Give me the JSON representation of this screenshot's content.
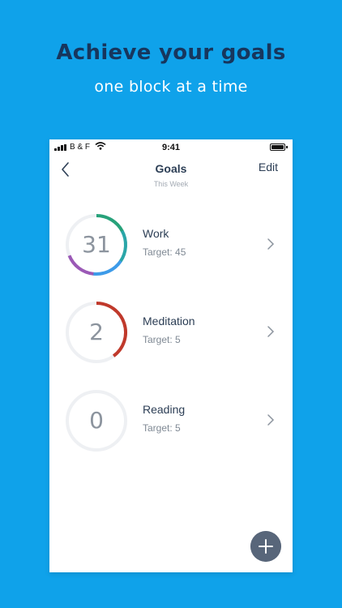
{
  "promo": {
    "headline": "Achieve your goals",
    "subline": "one block at a time"
  },
  "status_bar": {
    "carrier": "B & F",
    "time": "9:41"
  },
  "nav": {
    "title": "Goals",
    "subtitle": "This Week",
    "edit_label": "Edit",
    "back_icon": "chevron-left-icon"
  },
  "goals": [
    {
      "name": "Work",
      "count": "31",
      "target": "Target: 45",
      "progress": 0.69,
      "colors": [
        "#27a27a",
        "#2aa6a8",
        "#3d9be9",
        "#9b59b6"
      ]
    },
    {
      "name": "Meditation",
      "count": "2",
      "target": "Target: 5",
      "progress": 0.4,
      "colors": [
        "#c0392b"
      ]
    },
    {
      "name": "Reading",
      "count": "0",
      "target": "Target: 5",
      "progress": 0,
      "colors": []
    }
  ],
  "theme": {
    "background": "#0fa2ea",
    "headline_color": "#17365d",
    "track_color": "#eef0f3",
    "fab_color": "#58667a"
  },
  "fab": {
    "icon": "plus-icon"
  }
}
